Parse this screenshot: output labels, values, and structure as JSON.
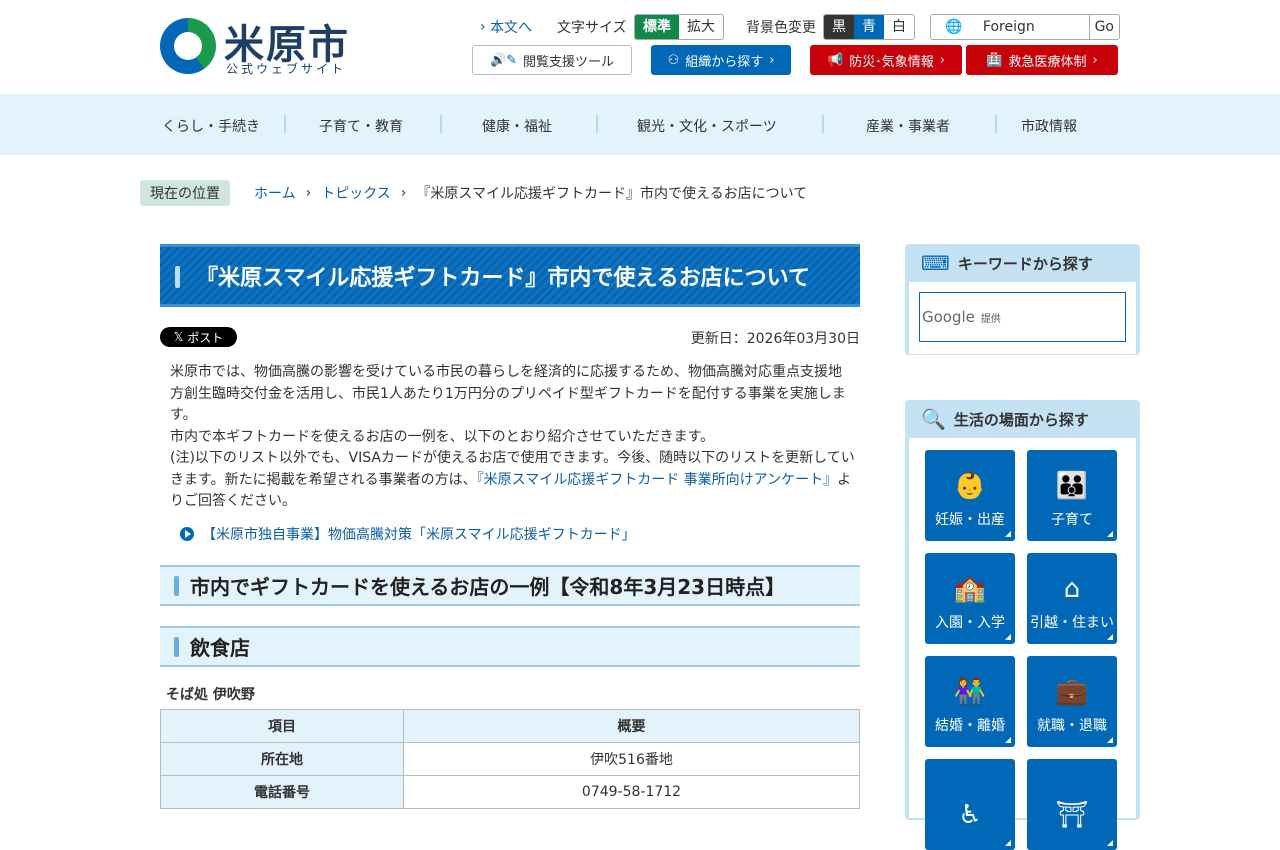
{
  "header": {
    "logo_title": "米原市",
    "logo_sub": "公式ウェブサイト",
    "skip": "本文へ",
    "font_size_label": "文字サイズ",
    "font_std": "標準",
    "font_large": "拡大",
    "bg_label": "背景色変更",
    "bg_black": "黒",
    "bg_blue": "青",
    "bg_white": "白",
    "language": "Foreign Language",
    "go": "Go",
    "tool": "閲覧支援ツール",
    "org": "組織から探す",
    "disaster": "防災･気象情報",
    "emergency": "救急医療体制"
  },
  "nav": [
    "くらし・手続き",
    "子育て・教育",
    "健康・福祉",
    "観光・文化・スポーツ",
    "産業・事業者",
    "市政情報"
  ],
  "breadcrumb": {
    "label": "現在の位置",
    "items": [
      "ホーム",
      "トピックス",
      "『米原スマイル応援ギフトカード』市内で使えるお店について"
    ]
  },
  "main": {
    "title": "『米原スマイル応援ギフトカード』市内で使えるお店について",
    "post": "ポスト",
    "updated": "更新日：2026年03月30日",
    "p1": "米原市では、物価高騰の影響を受けている市民の暮らしを経済的に応援するため、物価高騰対応重点支援地方創生臨時交付金を活用し、市民1人あたり1万円分のプリペイド型ギフトカードを配付する事業を実施します。",
    "p2": "市内で本ギフトカードを使えるお店の一例を、以下のとおり紹介させていただきます。",
    "p3a": "(注)以下のリスト以外でも、VISAカードが使えるお店で使用できます。今後、随時以下のリストを更新していきます。新たに掲載を希望される事業者の方は、",
    "p3link": "『米原スマイル応援ギフトカード 事業所向けアンケート』",
    "p3b": "よりご回答ください。",
    "link": "【米原市独自事業】物価高騰対策「米原スマイル応援ギフトカード」",
    "h2a": "市内でギフトカードを使えるお店の一例【令和8年3月23日時点】",
    "h2b": "飲食店",
    "shop": "そば処 伊吹野",
    "table": {
      "headers": [
        "項目",
        "概要"
      ],
      "rows": [
        [
          "所在地",
          "伊吹516番地"
        ],
        [
          "電話番号",
          "0749-58-1712"
        ]
      ]
    }
  },
  "sidebar": {
    "keyword_title": "キーワードから探す",
    "google": "Google",
    "provided": "提供",
    "life_title": "生活の場面から探す",
    "tiles": [
      {
        "label": "妊娠・出産",
        "icon": "👶"
      },
      {
        "label": "子育て",
        "icon": "👪"
      },
      {
        "label": "入園・入学",
        "icon": "🏫"
      },
      {
        "label": "引越・住まい",
        "icon": "⌂"
      },
      {
        "label": "結婚・離婚",
        "icon": "👫"
      },
      {
        "label": "就職・退職",
        "icon": "💼"
      },
      {
        "label": "",
        "icon": "♿"
      },
      {
        "label": "",
        "icon": "⛩"
      }
    ]
  }
}
